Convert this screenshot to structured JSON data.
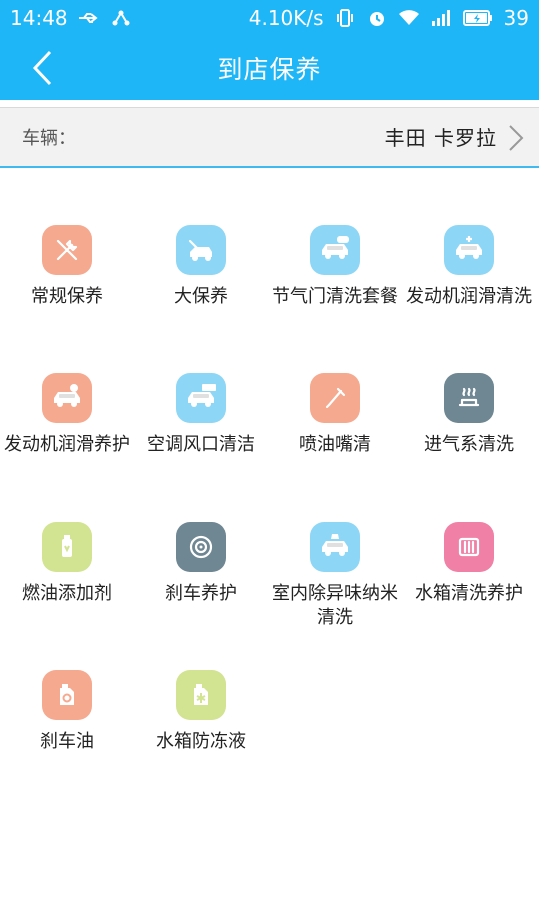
{
  "status": {
    "time": "14:48",
    "speed": "4.10K/s",
    "battery": "39"
  },
  "header": {
    "title": "到店保养"
  },
  "vehicle": {
    "label": "车辆：",
    "value": "丰田 卡罗拉"
  },
  "services": [
    {
      "label": "常规保养",
      "color": "#F5A98E",
      "icon": "tools-icon"
    },
    {
      "label": "大保养",
      "color": "#8ED6F6",
      "icon": "car-repair-icon"
    },
    {
      "label": "节气门清洗套餐",
      "color": "#8ED6F6",
      "icon": "car-throttle-icon"
    },
    {
      "label": "发动机润滑清洗",
      "color": "#8ED6F6",
      "icon": "car-engine-clean-icon"
    },
    {
      "label": "发动机润滑养护",
      "color": "#F5A98E",
      "icon": "car-engine-care-icon"
    },
    {
      "label": "空调风口清洁",
      "color": "#8ED6F6",
      "icon": "car-aircon-icon"
    },
    {
      "label": "喷油嘴清",
      "color": "#F5A98E",
      "icon": "injector-icon"
    },
    {
      "label": "进气系清洗",
      "color": "#6F8793",
      "icon": "intake-icon"
    },
    {
      "label": "燃油添加剂",
      "color": "#D2E391",
      "icon": "fuel-bottle-icon"
    },
    {
      "label": "刹车养护",
      "color": "#6F8793",
      "icon": "brake-disc-icon"
    },
    {
      "label": "室内除异味纳米清洗",
      "color": "#8ED6F6",
      "icon": "car-interior-icon"
    },
    {
      "label": "水箱清洗养护",
      "color": "#F080A6",
      "icon": "radiator-icon"
    },
    {
      "label": "刹车油",
      "color": "#F5A98E",
      "icon": "brake-oil-icon"
    },
    {
      "label": "水箱防冻液",
      "color": "#D2E391",
      "icon": "antifreeze-icon"
    }
  ]
}
